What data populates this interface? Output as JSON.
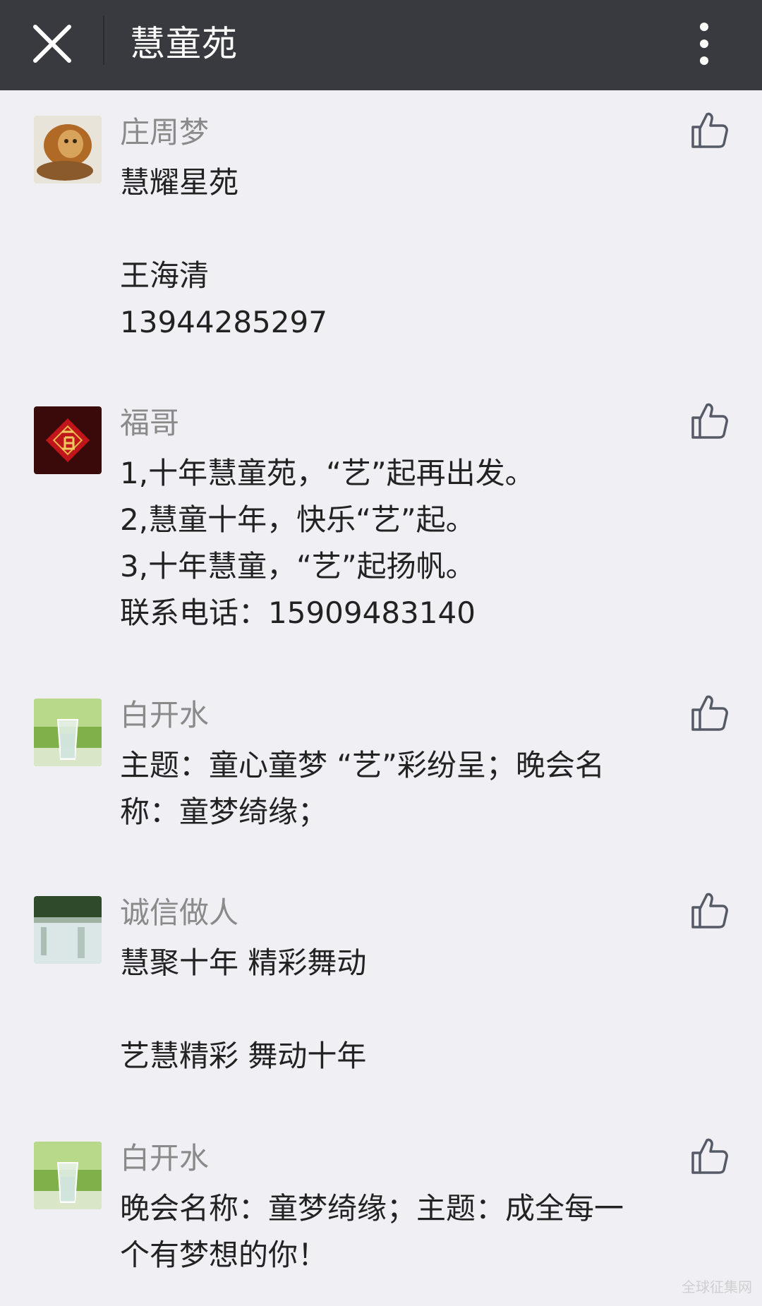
{
  "header": {
    "title": "慧童苑",
    "close_icon": "close-icon",
    "more_icon": "more-vertical-icon"
  },
  "comments": [
    {
      "name": "庄周梦",
      "avatar": "lion-avatar",
      "lines": [
        "慧耀星苑",
        "",
        "王海清",
        "13944285297"
      ]
    },
    {
      "name": "福哥",
      "avatar": "fu-character-avatar",
      "lines": [
        "1,十年慧童苑，“艺”起再出发。",
        "2,慧童十年，快乐“艺”起。",
        "3,十年慧童，“艺”起扬帆。",
        "联系电话：15909483140"
      ]
    },
    {
      "name": "白开水",
      "avatar": "water-glass-avatar",
      "lines": [
        "主题：童心童梦 “艺”彩纷呈；晚会名",
        "称：童梦绮缘；"
      ]
    },
    {
      "name": "诚信做人",
      "avatar": "lake-avatar",
      "lines": [
        "慧聚十年 精彩舞动",
        "",
        "艺慧精彩 舞动十年"
      ]
    },
    {
      "name": "白开水",
      "avatar": "water-glass-avatar",
      "lines": [
        "晚会名称：童梦绮缘；主题：成全每一",
        "个有梦想的你！"
      ]
    }
  ],
  "watermark": "全球征集网",
  "colors": {
    "topbar": "#393a3f",
    "background": "#efeff4",
    "name_text": "#8a8a8a",
    "body_text": "#222222",
    "like_icon": "#555a66"
  }
}
